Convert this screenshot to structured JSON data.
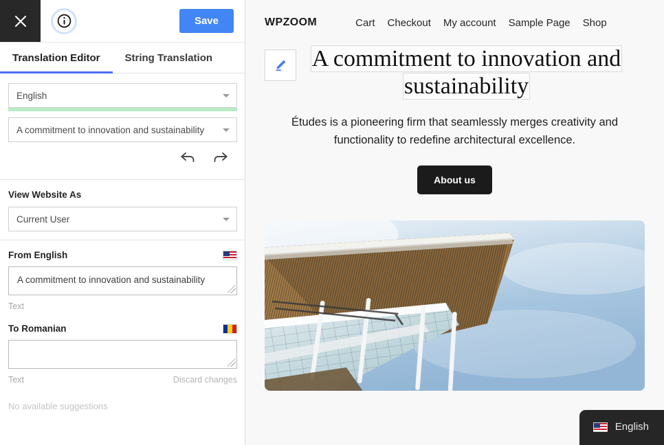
{
  "sidebar": {
    "topbar": {
      "close_label": "Close",
      "info_label": "Info",
      "save_label": "Save"
    },
    "tabs": [
      {
        "label": "Translation Editor",
        "active": true
      },
      {
        "label": "String Translation",
        "active": false
      }
    ],
    "language_select": {
      "value": "English"
    },
    "string_select": {
      "value": "A commitment to innovation and sustainability"
    },
    "history": {
      "undo_label": "Undo",
      "redo_label": "Redo"
    },
    "view_as": {
      "heading": "View Website As",
      "value": "Current User"
    },
    "from": {
      "heading": "From English",
      "flag": "us-flag-icon",
      "value": "A commitment to innovation and sustainability",
      "meta": "Text"
    },
    "to": {
      "heading": "To Romanian",
      "flag": "ro-flag-icon",
      "value": "",
      "placeholder": "",
      "meta": "Text",
      "discard_label": "Discard changes"
    },
    "suggestions": "No available suggestions"
  },
  "preview": {
    "brand": "WPZOOM",
    "nav": [
      {
        "label": "Cart"
      },
      {
        "label": "Checkout"
      },
      {
        "label": "My account"
      },
      {
        "label": "Sample Page"
      },
      {
        "label": "Shop"
      }
    ],
    "hero": {
      "edit_icon": "pencil-icon",
      "title_line1": "A commitment to innovation and",
      "title_line2": "sustainability",
      "subtitle": "Études is a pioneering firm that seamlessly merges creativity and functionality to redefine architectural excellence.",
      "cta_label": "About us"
    },
    "image_alt": "architecture-photo",
    "language_switcher": {
      "flag": "us-flag-icon",
      "label": "English"
    }
  },
  "colors": {
    "accent_blue": "#4285f4",
    "tab_underline": "#4c6ef5",
    "progress_green": "#b7ecc3",
    "dark": "#282828",
    "preview_bg": "#f8f8f8"
  }
}
